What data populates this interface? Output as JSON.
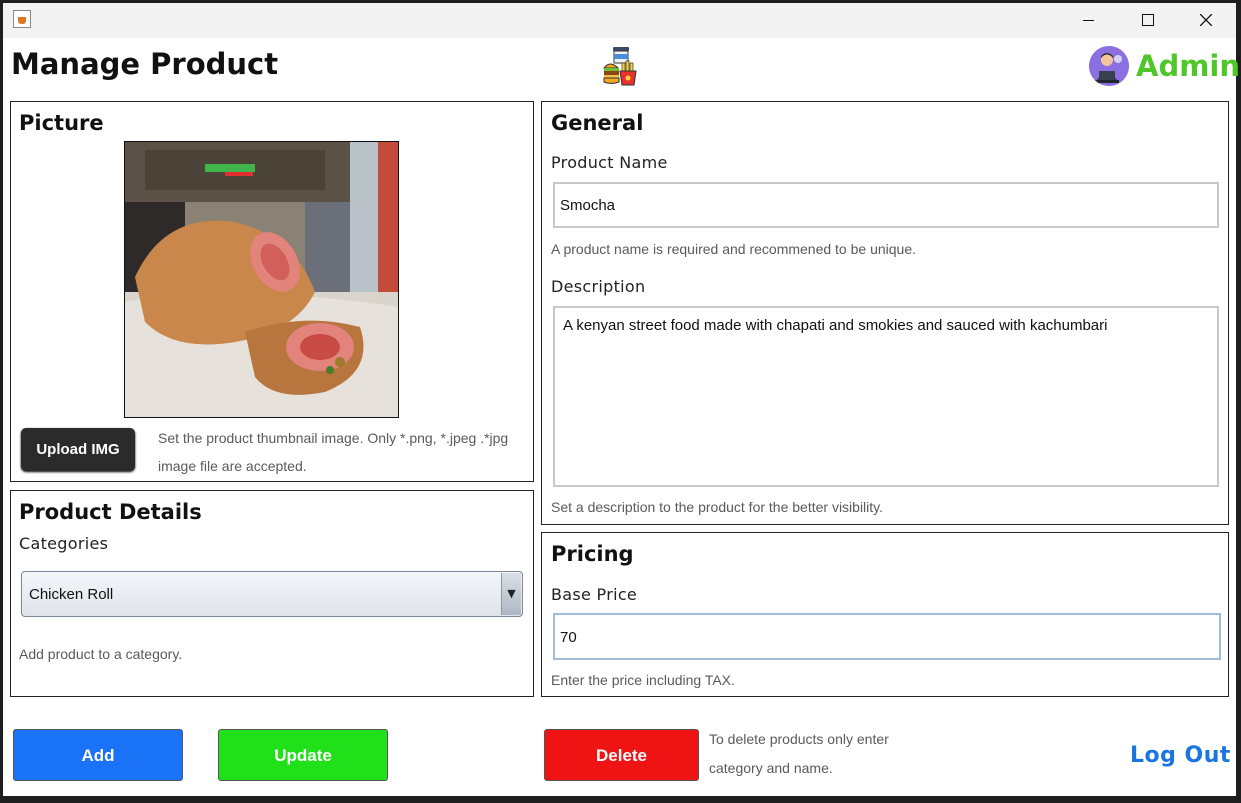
{
  "window": {
    "title": ""
  },
  "header": {
    "title": "Manage Product",
    "user": "Admin",
    "logo_icon": "fast-food-icon",
    "avatar_icon": "admin-avatar-icon"
  },
  "picture": {
    "title": "Picture",
    "upload_label": "Upload IMG",
    "hint": "Set the product thumbnail image. Only *.png, *.jpeg .*jpg image file are accepted."
  },
  "details": {
    "title": "Product Details",
    "categories_label": "Categories",
    "selected_category": "Chicken Roll",
    "hint": "Add product to a category."
  },
  "general": {
    "title": "General",
    "name_label": "Product Name",
    "name_value": "Smocha",
    "name_hint": "A product name is required and recommened to be unique.",
    "description_label": "Description",
    "description_value": "A kenyan street food made with chapati and smokies and sauced with kachumbari",
    "description_hint": "Set a description to the product for the better visibility."
  },
  "pricing": {
    "title": "Pricing",
    "base_price_label": "Base Price",
    "base_price_value": "70",
    "hint": "Enter the price including TAX."
  },
  "actions": {
    "add": "Add",
    "update": "Update",
    "delete": "Delete",
    "delete_hint": "To delete products only enter category and name.",
    "logout": "Log Out"
  },
  "colors": {
    "add": "#1a73f7",
    "update": "#1fe019",
    "delete": "#f01313",
    "admin": "#4fc72a",
    "logout": "#1976e0"
  }
}
